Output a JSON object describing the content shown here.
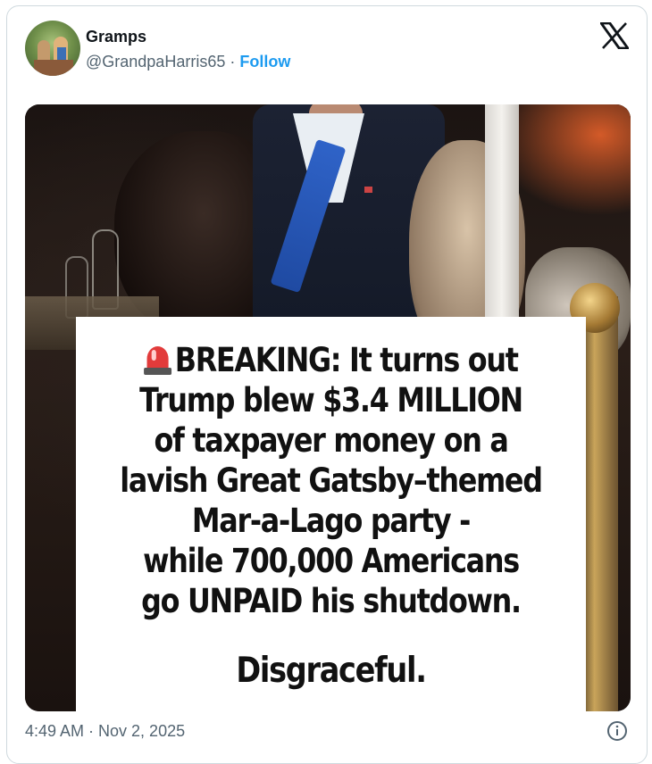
{
  "author": {
    "display_name": "Gramps",
    "handle": "@GrandpaHarris65",
    "separator": " · ",
    "follow_label": "Follow"
  },
  "media": {
    "caption_lines": [
      "BREAKING: It turns out",
      "Trump blew $3.4 MILLION",
      "of taxpayer money on a",
      "lavish Great Gatsby–themed",
      "Mar-a-Lago party -",
      "while 700,000 Americans",
      "go UNPAID his shutdown."
    ],
    "closing": "Disgraceful.",
    "leading_icon": "police-siren-icon"
  },
  "footer": {
    "timestamp": "4:49 AM · Nov 2, 2025",
    "info_icon": "info-circle-icon"
  },
  "colors": {
    "link": "#1d9bf0",
    "secondary_text": "#536471",
    "primary_text": "#0f1419",
    "border": "#cfd9de"
  },
  "icons": {
    "brand": "x-logo-icon"
  }
}
